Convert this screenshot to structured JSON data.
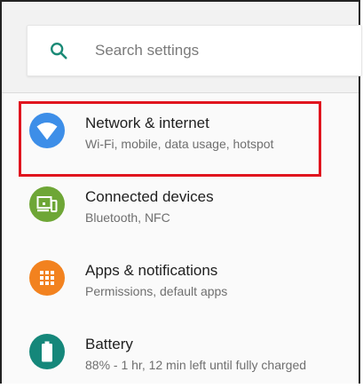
{
  "search": {
    "placeholder": "Search settings"
  },
  "items": [
    {
      "title": "Network & internet",
      "subtitle": "Wi-Fi, mobile, data usage, hotspot",
      "icon": "wifi-icon",
      "color": "#3d8ee8"
    },
    {
      "title": "Connected devices",
      "subtitle": "Bluetooth, NFC",
      "icon": "devices-icon",
      "color": "#6ea636"
    },
    {
      "title": "Apps & notifications",
      "subtitle": "Permissions, default apps",
      "icon": "apps-grid-icon",
      "color": "#f2821f"
    },
    {
      "title": "Battery",
      "subtitle": "88% - 1 hr, 12 min left until fully charged",
      "icon": "battery-icon",
      "color": "#15877a"
    }
  ],
  "colors": {
    "accent": "#1a8a76",
    "highlight": "#e0141e"
  }
}
